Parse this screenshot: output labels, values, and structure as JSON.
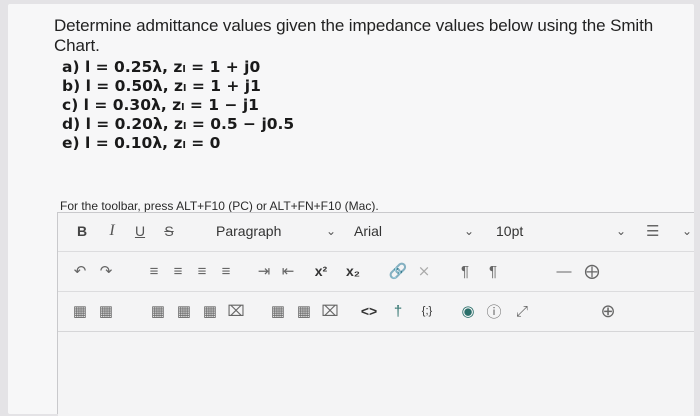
{
  "question": "Determine admittance values given the impedance values below using the Smith Chart.",
  "items": [
    "a) l = 0.25λ, zₗ = 1 + j0",
    "b) l = 0.50λ, zₗ = 1 + j1",
    "c) l = 0.30λ, zₗ = 1 − j1",
    "d) l = 0.20λ, zₗ = 0.5 − j0.5",
    "e) l = 0.10λ, zₗ = 0"
  ],
  "hint": "For the toolbar, press ALT+F10 (PC) or ALT+FN+F10 (Mac).",
  "toolbar": {
    "bold": "B",
    "italic": "I",
    "underline": "U",
    "strike": "S",
    "paragraph": "Paragraph",
    "font": "Arial",
    "size": "10pt",
    "superscript": "x²",
    "subscript": "x₂",
    "code": "<>",
    "braces": "{;}"
  }
}
